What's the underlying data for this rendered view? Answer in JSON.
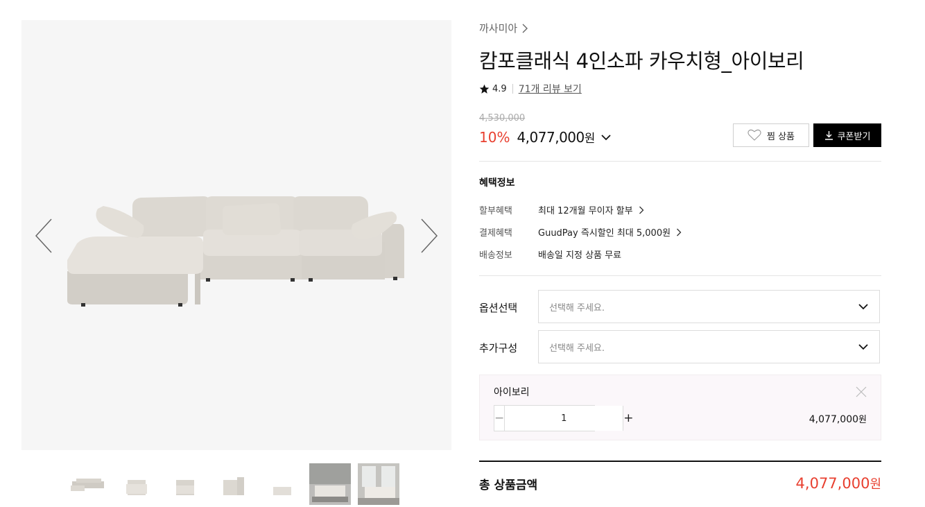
{
  "gallery": {
    "thumbnails": [
      "thumb-1",
      "thumb-2",
      "thumb-3",
      "thumb-4",
      "thumb-5",
      "thumb-6",
      "thumb-7"
    ]
  },
  "product": {
    "brand": "까사미아",
    "title": "캄포클래식 4인소파 카우치형_아이보리",
    "rating": "4.9",
    "review_link": "71개 리뷰 보기",
    "original_price": "4,530,000",
    "discount": "10%",
    "price": "4,077,000",
    "price_unit": "원"
  },
  "actions": {
    "wish_label": "찜 상품",
    "coupon_label": "쿠폰받기"
  },
  "benefits": {
    "title": "혜택정보",
    "rows": [
      {
        "label": "할부혜택",
        "value": "최대 12개월 무이자 할부"
      },
      {
        "label": "결제혜택",
        "value": "GuudPay 즉시할인 최대 5,000원"
      },
      {
        "label": "배송정보",
        "value": "배송일 지정 상품 무료"
      }
    ]
  },
  "options": {
    "option_label": "옵션선택",
    "option_placeholder": "선택해 주세요.",
    "extra_label": "추가구성",
    "extra_placeholder": "선택해 주세요."
  },
  "selected": {
    "name": "아이보리",
    "quantity": "1",
    "line_price": "4,077,000",
    "unit": "원"
  },
  "total": {
    "label": "총 상품금액",
    "price": "4,077,000",
    "unit": "원"
  },
  "colors": {
    "accent_red": "#e83f2f",
    "coupon_bg": "#000000"
  }
}
